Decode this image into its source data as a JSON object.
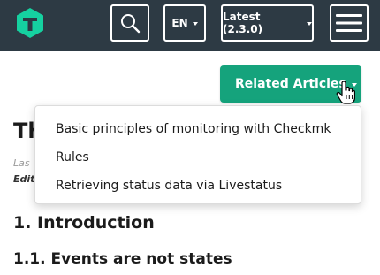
{
  "header": {
    "background_color": "#2d3a44",
    "logo_icon": "checkmk-logo-icon",
    "logo_color": "#15d1a0",
    "search_icon": "search-icon",
    "language_label": "EN",
    "version_label": "Latest (2.3.0)",
    "menu_icon": "hamburger-menu-icon"
  },
  "related": {
    "button_label": "Related Articles",
    "button_color": "#15a37c",
    "cursor_icon": "hand-pointer-icon",
    "items": [
      {
        "label": "Basic principles of monitoring with Checkmk"
      },
      {
        "label": "Rules"
      },
      {
        "label": "Retrieving status data via Livestatus"
      }
    ]
  },
  "article": {
    "title_visible": "Th",
    "meta_last_visible": "Las",
    "meta_edit_visible": "Edit",
    "h1": "1. Introduction",
    "h2": "1.1. Events are not states"
  }
}
